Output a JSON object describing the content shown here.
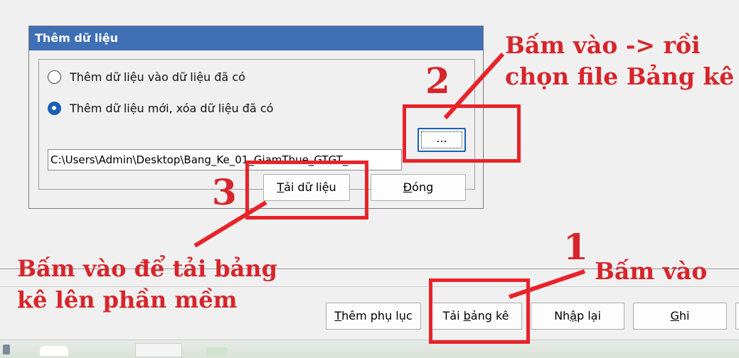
{
  "dialog": {
    "title": "Thêm dữ liệu",
    "option1": "Thêm dữ liệu vào dữ liệu đã có",
    "option2": "Thêm dữ liệu mới, xóa dữ liệu đã có",
    "selected_option": 2,
    "file_path": "C:\\Users\\Admin\\Desktop\\Bang_Ke_01_GiamThue_GTGT_",
    "browse_label": "...",
    "load_underlined": "T",
    "load_rest": "ải dữ liệu",
    "close_underlined": "Đ",
    "close_rest": "óng"
  },
  "toolbar": {
    "appendix_pre": "T",
    "appendix_u": "h",
    "appendix_post": "êm phụ lục",
    "load_list_pre": "Tải ",
    "load_list_u": "b",
    "load_list_post": "ảng kê",
    "reset_pre": "Nh",
    "reset_u": "ậ",
    "reset_post": "p lại",
    "save_u": "G",
    "save_post": "hi"
  },
  "annotations": {
    "step1_number": "1",
    "step1_text": "Bấm vào",
    "step2_number": "2",
    "step2_line1": "Bấm vào -> rồi",
    "step2_line2": "chọn file Bảng kê",
    "step3_number": "3",
    "step3_line1": "Bấm vào để tải bảng",
    "step3_line2": "kê lên phần mềm",
    "color": "#e8232a"
  }
}
